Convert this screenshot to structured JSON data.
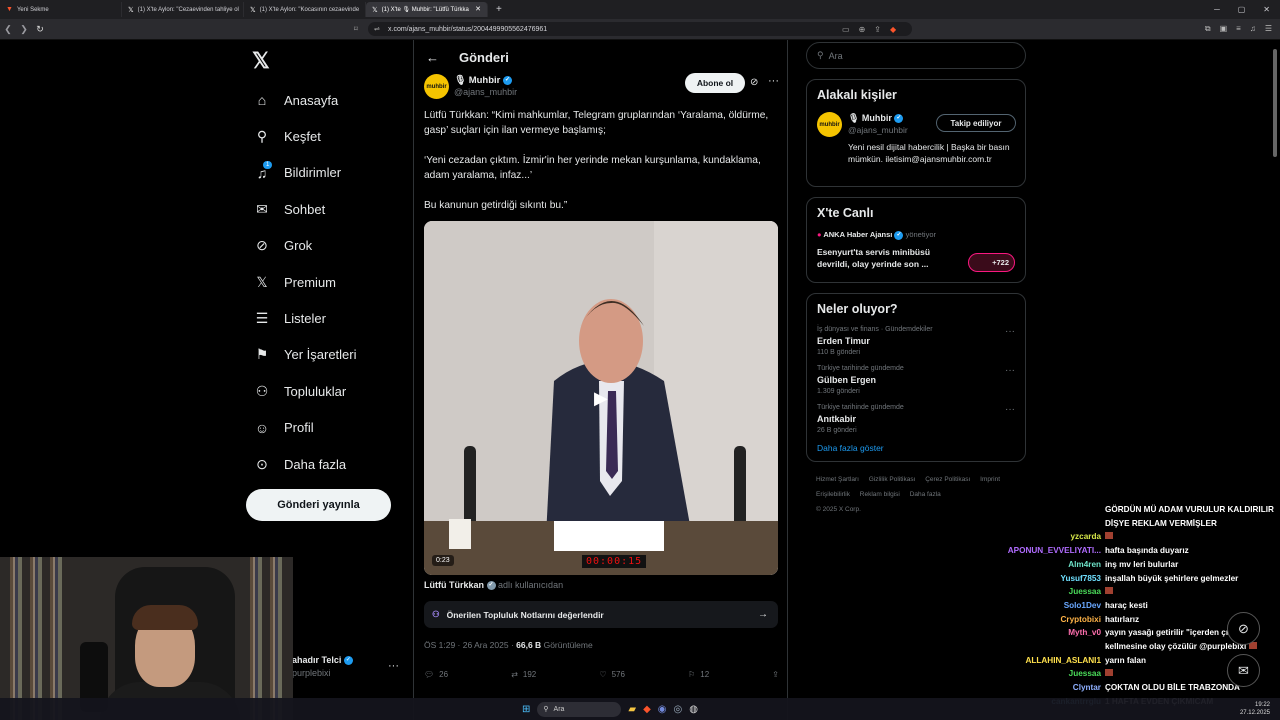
{
  "browser": {
    "tabs": [
      {
        "label": "Yeni Sekme",
        "active": false
      },
      {
        "label": "(1) X'te Aylon: \"Cezaevinden tahliye ol",
        "active": false
      },
      {
        "label": "(1) X'te Aylon: \"Kocasının cezaevinde",
        "active": false
      },
      {
        "label": "(1) X'te 🎙 Muhbir: \"Lütfü Türkka",
        "active": true
      }
    ],
    "url": "x.com/ajans_muhbir/status/2004499905562476961"
  },
  "sidebar": {
    "items": [
      {
        "label": "Anasayfa",
        "icon": "home-icon"
      },
      {
        "label": "Keşfet",
        "icon": "search-icon"
      },
      {
        "label": "Bildirimler",
        "icon": "bell-icon",
        "badge": "1"
      },
      {
        "label": "Sohbet",
        "icon": "mail-icon"
      },
      {
        "label": "Grok",
        "icon": "grok-icon"
      },
      {
        "label": "Premium",
        "icon": "x-icon"
      },
      {
        "label": "Listeler",
        "icon": "list-icon"
      },
      {
        "label": "Yer İşaretleri",
        "icon": "bookmark-icon"
      },
      {
        "label": "Topluluklar",
        "icon": "communities-icon"
      },
      {
        "label": "Profil",
        "icon": "profile-icon"
      },
      {
        "label": "Daha fazla",
        "icon": "more-icon"
      }
    ],
    "post_button": "Gönderi yayınla",
    "account": {
      "name": "ahadır Telci",
      "handle": "purplebixi"
    }
  },
  "main": {
    "header_title": "Gönderi",
    "author": {
      "avatar_text": "muhbir",
      "name": "🎙 Muhbir",
      "handle": "@ajans_muhbir"
    },
    "follow_label": "Abone ol",
    "text": "Lütfü Türkkan: “Kimi mahkumlar, Telegram gruplarından ‘Yaralama, öldürme, gasp’ suçları için ilan vermeye başlamış;\n\n‘Yeni cezadan çıktım. İzmir'in her yerinde mekan kurşunlama, kundaklama, adam yaralama, infaz...’\n\nBu kanunun getirdiği sıkıntı bu.”",
    "video": {
      "duration": "0:23",
      "clock_display": "00:00:15"
    },
    "video_user": {
      "name": "Lütfü Türkkan",
      "note": "adlı kullanıcıdan"
    },
    "community_notes": "Önerilen Topluluk Notlarını değerlendir",
    "meta": {
      "time": "ÖS 1:29 · 26 Ara 2025 ·",
      "views": "66,6 B",
      "views_label": "Görüntüleme"
    },
    "actions": {
      "replies": "26",
      "reposts": "192",
      "likes": "576",
      "bookmarks": "12"
    }
  },
  "right": {
    "search_placeholder": "Ara",
    "related_title": "Alakalı kişiler",
    "related": {
      "avatar_text": "muhbir",
      "name": "🎙 Muhbir",
      "handle": "@ajans_muhbir",
      "bio": "Yeni nesil dijital habercilik | Başka bir basın mümkün. iletisim@ajansmuhbir.com.tr",
      "button": "Takip ediliyor"
    },
    "live_title": "X'te Canlı",
    "live": {
      "source": "ANKA Haber Ajansı",
      "role": "yönetiyor",
      "headline": "Esenyurt'ta servis minibüsü devrildi, olay yerinde son ...",
      "count": "+722"
    },
    "trends_title": "Neler oluyor?",
    "trends": [
      {
        "category": "İş dünyası ve finans · Gündemdekiler",
        "title": "Erden Timur",
        "count": "110 B gönderi"
      },
      {
        "category": "Türkiye tarihinde gündemde",
        "title": "Gülben Ergen",
        "count": "1.309 gönderi"
      },
      {
        "category": "Türkiye tarihinde gündemde",
        "title": "Anıtkabir",
        "count": "26 B gönderi"
      }
    ],
    "show_more": "Daha fazla göster",
    "footer": [
      "Hizmet Şartları",
      "Gizlilik Politikası",
      "Çerez Politikası",
      "Imprint",
      "Erişilebilirlik",
      "Reklam bilgisi",
      "Daha fazla",
      "© 2025 X Corp."
    ]
  },
  "chat": [
    {
      "user": "",
      "msg": "GÖRDÜN MÜ ADAM VURULUR KALDIRILIR DİŞYE REKLAM VERMİŞLER",
      "color": "#ffffff"
    },
    {
      "user": "yzcarda",
      "msg": "",
      "color": "#d7e84a",
      "emote": true
    },
    {
      "user": "APONUN_EVVELIYATI...",
      "msg": "hafta başında duyarız",
      "color": "#b06cff"
    },
    {
      "user": "Alm4ren",
      "msg": "inş mv leri bulurlar",
      "color": "#6ee3c9"
    },
    {
      "user": "Yusuf7853",
      "msg": "inşallah büyük şehirlere gelmezler",
      "color": "#6fe0ff"
    },
    {
      "user": "Juessaa",
      "msg": "",
      "color": "#4bdc5a",
      "emote": true
    },
    {
      "user": "Solo1Dev",
      "msg": "haraç kesti",
      "color": "#6aa8ff"
    },
    {
      "user": "Cryptobixi",
      "msg": "hatırlarız",
      "color": "#ffb347"
    },
    {
      "user": "Myth_v0",
      "msg": "yayın yasağı getirilir \"içerden çıktı\" kellmesine olay çözülür @purplebixi",
      "color": "#ff6fae",
      "emote": true
    },
    {
      "user": "ALLAHIN_ASLANI1",
      "msg": "yarın falan",
      "color": "#ffe14d"
    },
    {
      "user": "Juessaa",
      "msg": "",
      "color": "#4bdc5a",
      "emote": true
    },
    {
      "user": "Clyntar",
      "msg": "ÇOKTAN OLDU BİLE TRABZONDA",
      "color": "#8fb0ff"
    },
    {
      "user": "cankantrrglu",
      "msg": "1 HAFTA EVDEN ÇIKMICAM",
      "color": "#8fd6ff"
    }
  ],
  "taskbar": {
    "search": "Ara",
    "time": "19:22",
    "date": "27.12.2025"
  }
}
